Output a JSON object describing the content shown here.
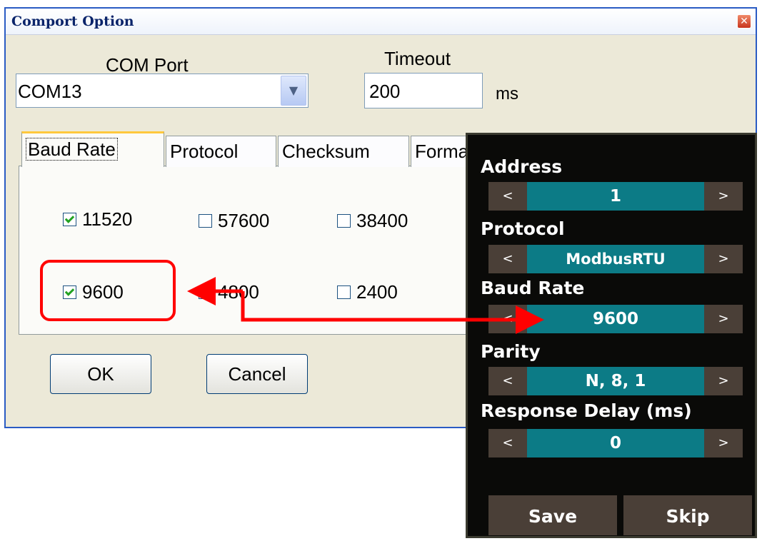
{
  "dialog": {
    "title": "Comport Option",
    "com_port_label": "COM Port",
    "com_port_value": "COM13",
    "timeout_label": "Timeout",
    "timeout_value": "200",
    "timeout_unit": "ms",
    "tabs": [
      {
        "label": "Baud Rate",
        "active": true
      },
      {
        "label": "Protocol",
        "active": false
      },
      {
        "label": "Checksum",
        "active": false
      },
      {
        "label": "Format",
        "active": false
      }
    ],
    "baud_rates": [
      {
        "label": "11520",
        "checked": true
      },
      {
        "label": "57600",
        "checked": false
      },
      {
        "label": "38400",
        "checked": false
      },
      {
        "label": "9600",
        "checked": true
      },
      {
        "label": "4800",
        "checked": false
      },
      {
        "label": "2400",
        "checked": false
      }
    ],
    "ok_label": "OK",
    "cancel_label": "Cancel"
  },
  "device": {
    "fields": [
      {
        "label": "Address",
        "value": "1"
      },
      {
        "label": "Protocol",
        "value": "ModbusRTU"
      },
      {
        "label": "Baud Rate",
        "value": "9600"
      },
      {
        "label": "Parity",
        "value": "N, 8, 1"
      },
      {
        "label": "Response Delay (ms)",
        "value": "0"
      }
    ],
    "left_arrow": "<",
    "right_arrow": ">",
    "save_label": "Save",
    "skip_label": "Skip"
  },
  "colors": {
    "highlight": "#ff0000",
    "device_value_bg": "#0c7b86",
    "device_arrow_bg": "#4a3f37",
    "title_text": "#0a246a"
  }
}
